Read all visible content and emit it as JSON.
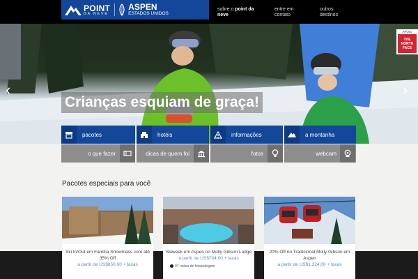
{
  "header": {
    "logo_point": "POINT",
    "logo_point_sub": "DA NEVE",
    "logo_aspen": "ASPEN",
    "logo_aspen_sub": "ESTADOS UNIDOS",
    "nav": [
      {
        "prefix": "sobre o ",
        "bold": "point da",
        "line2": "neve"
      },
      {
        "prefix": "entre em",
        "bold": "",
        "line2": "contato"
      },
      {
        "prefix": "outros",
        "bold": "",
        "line2": "destinos"
      }
    ]
  },
  "hero": {
    "title": "Crianças esquiam de graça!",
    "prev_arrow": "‹",
    "next_arrow": "›",
    "sponsor_label": "APOIO",
    "sponsor_name": "THE NORTH FACE"
  },
  "categories": [
    {
      "label": "pacotes",
      "icon": "shop-icon"
    },
    {
      "label": "hotéis",
      "icon": "hotel-icon"
    },
    {
      "label": "informações",
      "icon": "warning-icon"
    },
    {
      "label": "a montanha",
      "icon": "mountain-icon"
    },
    {
      "label": "o que fazer",
      "icon": "ticket-icon"
    },
    {
      "label": "dicas de quem foi",
      "icon": "bank-icon"
    },
    {
      "label": "fotos",
      "icon": "lightbulb-icon"
    },
    {
      "label": "webcam",
      "icon": "image-icon"
    },
    {
      "label": "",
      "icon": "webcam-icon"
    }
  ],
  "section": {
    "title": "Pacotes especiais para você"
  },
  "packages": [
    {
      "title": "Ski In/Out em Família Snowmass com até 35% Off",
      "price": "a partir de US$850,00 + taxas",
      "extra": ""
    },
    {
      "title": "Skiweek em Aspen no Molly Gibson Lodge",
      "price": "a partir de US$704,00 + taxas",
      "extra": "07 noites de hospedagem"
    },
    {
      "title": "20% Off no Tradicional Molly Gibson em Aspen",
      "price": "a partir de US$1.224,00 + taxas",
      "extra": ""
    }
  ],
  "colors": {
    "brand_blue": "#12479a",
    "gray_tile": "#8d8d8d",
    "price_blue": "#5a8ac7"
  }
}
